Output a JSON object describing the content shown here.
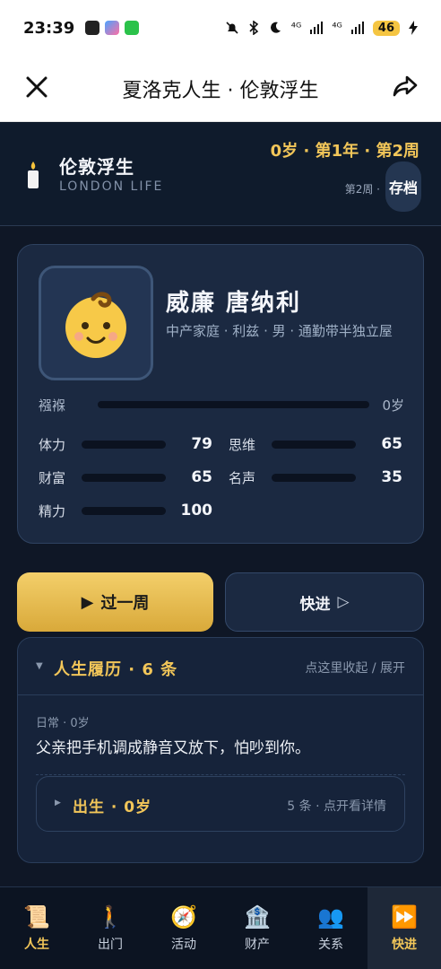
{
  "status_bar": {
    "time": "23:39",
    "signal_1": "⁴ᴳ",
    "signal_2": "⁴ᴳ",
    "battery": "46"
  },
  "nav": {
    "title": "夏洛克人生 · 伦敦浮生",
    "close_icon": "close-icon",
    "share_icon": "share-icon"
  },
  "game_header": {
    "title": "伦敦浮生",
    "subtitle": "LONDON LIFE",
    "age_text": "0岁 · 第1年 · 第2周",
    "week_text": "第2周 ·",
    "save_label": "存档"
  },
  "character": {
    "avatar": "👶",
    "name": "威廉 唐纳利",
    "description": "中产家庭 · 利兹 · 男 · 通勤带半独立屋",
    "stage_label": "襁褓",
    "stage_age": "0岁",
    "stats": [
      {
        "label": "体力",
        "value": 79,
        "color": "#6ec56a"
      },
      {
        "label": "思维",
        "value": 65,
        "color": "#6aa7e6"
      },
      {
        "label": "财富",
        "value": 65,
        "color": "#f1c75c"
      },
      {
        "label": "名声",
        "value": 35,
        "color": "#b39ee6"
      },
      {
        "label": "精力",
        "value": 100,
        "color": "#4fd1c5"
      }
    ]
  },
  "actions": {
    "primary_icon": "▶",
    "primary_label": "过一周",
    "secondary_label": "快进",
    "secondary_icon": "▷"
  },
  "log": {
    "caret": "▼",
    "title": "人生履历 · 6 条",
    "toggle": "点这里收起 / 展开",
    "entry_meta": "日常 · 0岁",
    "entry_text": "父亲把手机调成静音又放下，怕吵到你。",
    "group_caret": "▶",
    "group_title": "出生 · 0岁",
    "group_hint": "5 条 · 点开看详情"
  },
  "tabs": [
    {
      "icon": "📜",
      "label": "人生"
    },
    {
      "icon": "🚶",
      "label": "出门"
    },
    {
      "icon": "🧭",
      "label": "活动"
    },
    {
      "icon": "🏦",
      "label": "财产"
    },
    {
      "icon": "👥",
      "label": "关系"
    },
    {
      "icon": "⏩",
      "label": "快进"
    }
  ],
  "colors": {
    "accent": "#f2c659",
    "background": "#0f1726",
    "card": "#1b2941"
  }
}
